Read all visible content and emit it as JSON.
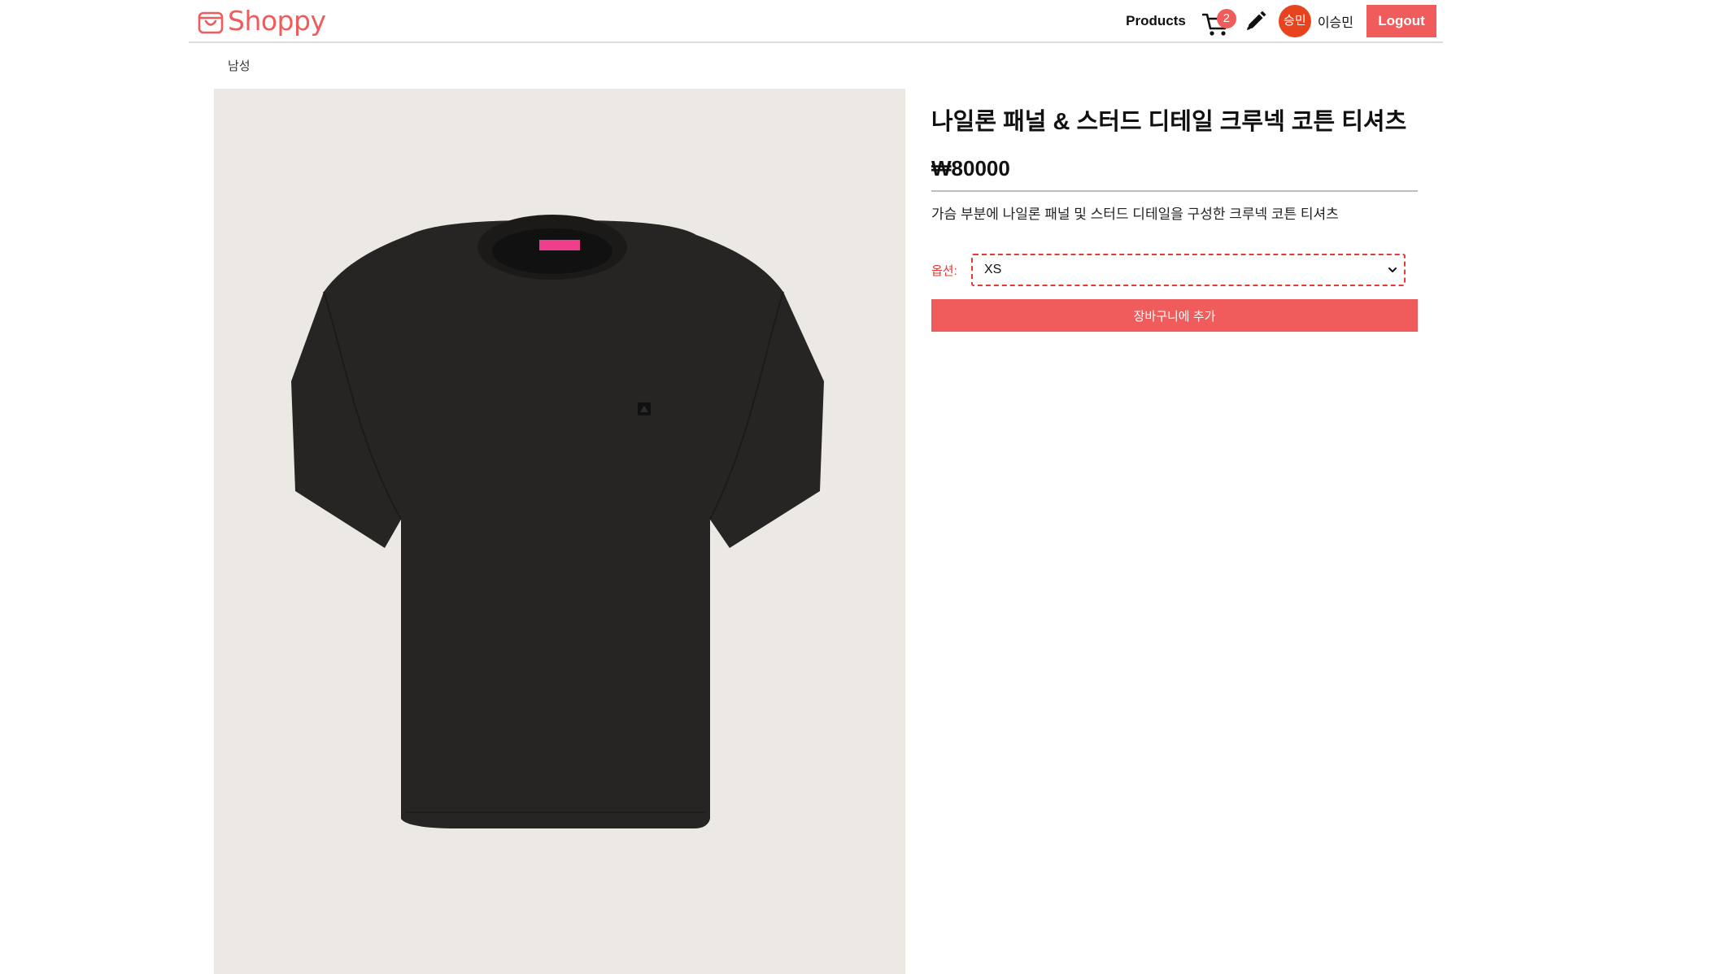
{
  "header": {
    "logo_text": "Shoppy",
    "nav_products": "Products",
    "cart_count": "2",
    "avatar_text": "승민",
    "username": "이승민",
    "logout_label": "Logout"
  },
  "breadcrumb": "남성",
  "product": {
    "title": "나일론 패널 & 스터드 디테일 크루넥 코튼 티셔츠",
    "price": "₩80000",
    "description": "가슴 부분에 나일론 패널 및 스터드 디테일을 구성한 크루넥 코튼 티셔츠",
    "option_label": "옵션:",
    "selected_option": "XS",
    "add_to_cart_label": "장바구니에 추가"
  },
  "colors": {
    "brand": "#f05b5b",
    "avatar_bg": "#e8431f",
    "image_bg": "#ece9e5",
    "shirt": "#262523",
    "patch": "#ef3e8c"
  }
}
